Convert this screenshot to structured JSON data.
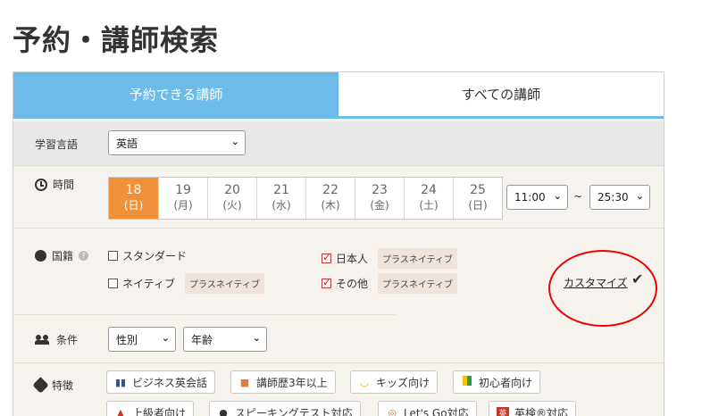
{
  "page": {
    "title": "予約・講師検索"
  },
  "tabs": [
    {
      "label": "予約できる講師"
    },
    {
      "label": "すべての講師"
    }
  ],
  "language": {
    "label": "学習言語",
    "value": "英語"
  },
  "time": {
    "label": "時間",
    "dates": [
      {
        "day": "18",
        "dow": "(日)"
      },
      {
        "day": "19",
        "dow": "(月)"
      },
      {
        "day": "20",
        "dow": "(火)"
      },
      {
        "day": "21",
        "dow": "(水)"
      },
      {
        "day": "22",
        "dow": "(木)"
      },
      {
        "day": "23",
        "dow": "(金)"
      },
      {
        "day": "24",
        "dow": "(土)"
      },
      {
        "day": "25",
        "dow": "(日)"
      }
    ],
    "from": "11:00",
    "tilde": "~",
    "to": "25:30"
  },
  "nationality": {
    "label": "国籍",
    "options": [
      {
        "label": "スタンダード",
        "checked": false
      },
      {
        "label": "ネイティブ",
        "checked": false,
        "tag": "プラスネイティブ"
      },
      {
        "label": "日本人",
        "checked": true,
        "tag": "プラスネイティブ"
      },
      {
        "label": "その他",
        "checked": true,
        "tag": "プラスネイティブ"
      }
    ],
    "customize": "カスタマイズ"
  },
  "conditions": {
    "label": "条件",
    "gender": "性別",
    "age": "年齢"
  },
  "features": {
    "label": "特徴",
    "items": [
      {
        "label": "ビジネス英会話",
        "icon": "books-icon"
      },
      {
        "label": "講師歴3年以上",
        "icon": "box-icon"
      },
      {
        "label": "キッズ向け",
        "icon": "smile-icon"
      },
      {
        "label": "初心者向け",
        "icon": "beginner-mark-icon"
      },
      {
        "label": "上級者向け",
        "icon": "graduation-cap-icon"
      },
      {
        "label": "スピーキングテスト対応",
        "icon": "microphone-icon"
      },
      {
        "label": "Let's Go対応",
        "icon": "letsgo-icon"
      },
      {
        "label": "英検®対応",
        "icon": "eiken-icon"
      }
    ]
  },
  "colors": {
    "accent": "#6cbbe8",
    "selected_date": "#f0913a",
    "annotation": "#e00000"
  }
}
